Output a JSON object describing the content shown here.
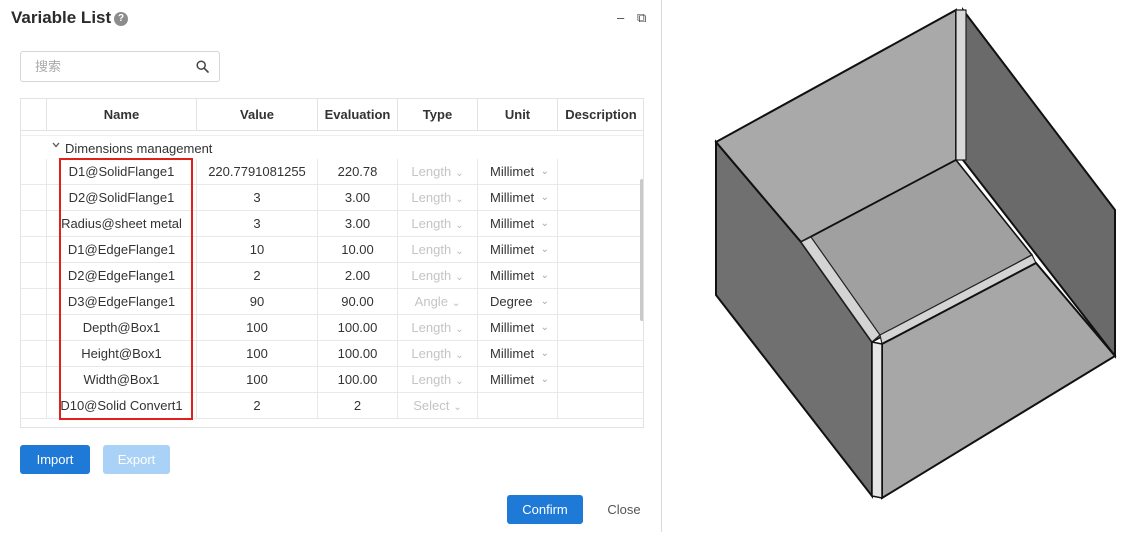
{
  "dialog": {
    "title": "Variable List",
    "help_glyph": "?",
    "minimize_glyph": "–",
    "restore_glyph": "⧉"
  },
  "search": {
    "placeholder": "搜索",
    "value": ""
  },
  "table": {
    "columns": [
      "Name",
      "Value",
      "Evaluation",
      "Type",
      "Unit",
      "Description"
    ],
    "group": {
      "label": "Dimensions management",
      "expanded": true
    },
    "rows": [
      {
        "name": "D1@SolidFlange1",
        "value": "220.7791081255",
        "evaluation": "220.78",
        "type": "Length",
        "unit": "Millimet"
      },
      {
        "name": "D2@SolidFlange1",
        "value": "3",
        "evaluation": "3.00",
        "type": "Length",
        "unit": "Millimet"
      },
      {
        "name": "Radius@sheet metal",
        "value": "3",
        "evaluation": "3.00",
        "type": "Length",
        "unit": "Millimet"
      },
      {
        "name": "D1@EdgeFlange1",
        "value": "10",
        "evaluation": "10.00",
        "type": "Length",
        "unit": "Millimet"
      },
      {
        "name": "D2@EdgeFlange1",
        "value": "2",
        "evaluation": "2.00",
        "type": "Length",
        "unit": "Millimet"
      },
      {
        "name": "D3@EdgeFlange1",
        "value": "90",
        "evaluation": "90.00",
        "type": "Angle",
        "unit": "Degree"
      },
      {
        "name": "Depth@Box1",
        "value": "100",
        "evaluation": "100.00",
        "type": "Length",
        "unit": "Millimet"
      },
      {
        "name": "Height@Box1",
        "value": "100",
        "evaluation": "100.00",
        "type": "Length",
        "unit": "Millimet"
      },
      {
        "name": "Width@Box1",
        "value": "100",
        "evaluation": "100.00",
        "type": "Length",
        "unit": "Millimet"
      },
      {
        "name": "D10@Solid Convert1",
        "value": "2",
        "evaluation": "2",
        "type": "Select",
        "unit": ""
      }
    ]
  },
  "buttons": {
    "import": "Import",
    "export": "Export",
    "confirm": "Confirm",
    "close": "Close"
  },
  "colors": {
    "accent": "#1e7ad6",
    "accent_disabled": "#a9d2f6",
    "highlight": "#e0201d"
  },
  "icons": {
    "search": "search-icon",
    "help": "help-icon",
    "minimize": "minimize-icon",
    "restore": "restore-icon",
    "chevron": "chevron-down-icon"
  }
}
